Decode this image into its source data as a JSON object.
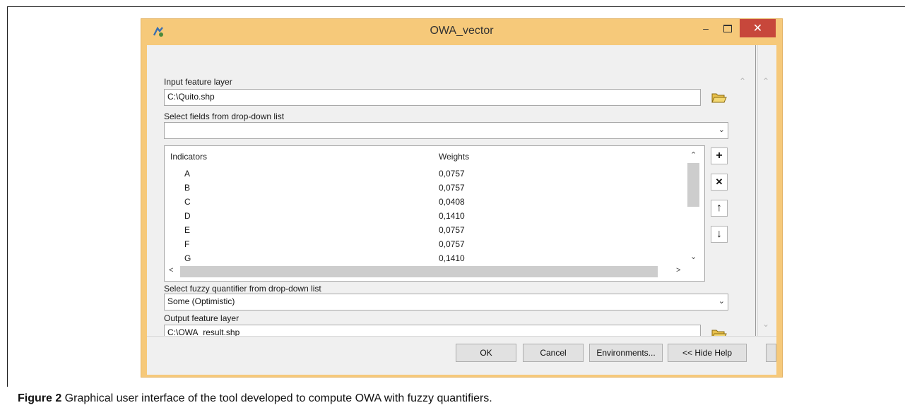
{
  "window": {
    "title": "OWA_vector",
    "min_glyph": "–",
    "close_glyph": "✕",
    "accent_frame": "#f6c97a",
    "close_color": "#c7473b"
  },
  "form": {
    "input_label": "Input feature layer",
    "input_value": "C:\\Quito.shp",
    "fields_label": "Select fields from drop-down list",
    "fields_value": "",
    "quantifier_label": "Select fuzzy quantifier from drop-down list",
    "quantifier_value": "Some (Optimistic)",
    "output_label": "Output feature layer",
    "output_value": "C:\\OWA_result.shp"
  },
  "table": {
    "columns": [
      "Indicators",
      "Weights"
    ],
    "rows": [
      {
        "indicator": "A",
        "weight": "0,0757"
      },
      {
        "indicator": "B",
        "weight": "0,0757"
      },
      {
        "indicator": "C",
        "weight": "0,0408"
      },
      {
        "indicator": "D",
        "weight": "0,1410"
      },
      {
        "indicator": "E",
        "weight": "0,0757"
      },
      {
        "indicator": "F",
        "weight": "0,0757"
      },
      {
        "indicator": "G",
        "weight": "0,1410"
      }
    ]
  },
  "side_buttons": {
    "add": "+",
    "remove": "✕",
    "up": "↑",
    "down": "↓"
  },
  "buttons": {
    "ok": "OK",
    "cancel": "Cancel",
    "environments": "Environments...",
    "hide_help": "<< Hide Help"
  },
  "icons": {
    "app": "arcgis-tool-icon",
    "browse": "open-folder-icon"
  },
  "caption": {
    "figure": "Figure 2",
    "text": " Graphical user interface of the tool developed to compute OWA with fuzzy quantifiers."
  }
}
